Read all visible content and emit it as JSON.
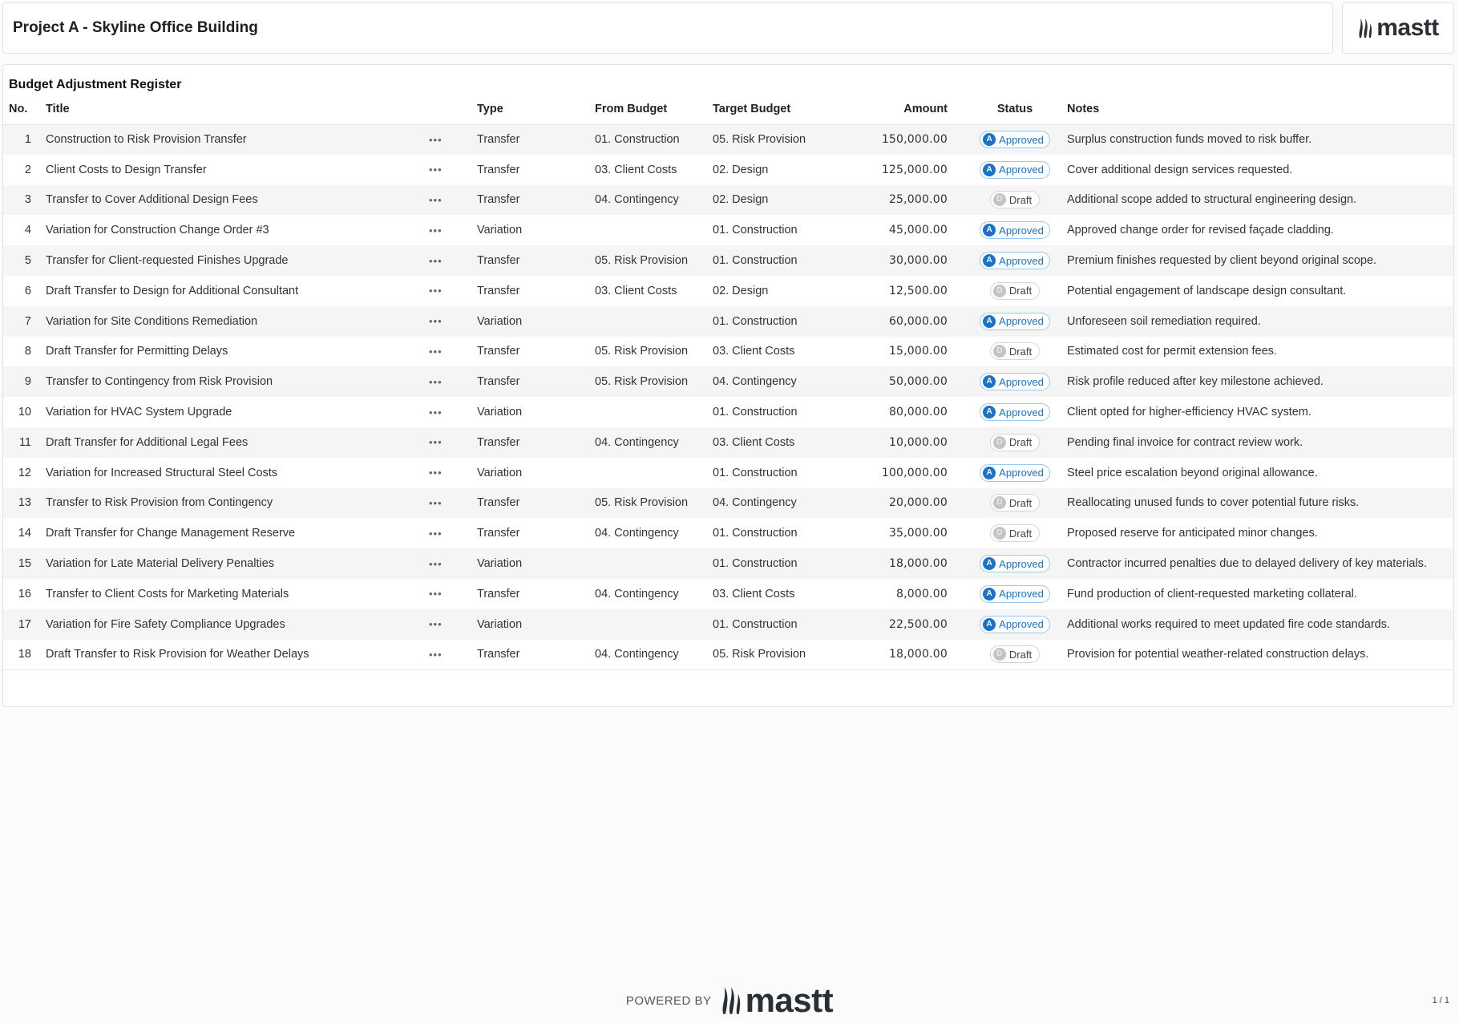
{
  "header": {
    "project_title": "Project A - Skyline Office Building",
    "logo_text": "mastt"
  },
  "register": {
    "title": "Budget Adjustment Register",
    "columns": {
      "no": "No.",
      "title": "Title",
      "type": "Type",
      "from": "From Budget",
      "target": "Target Budget",
      "amount": "Amount",
      "status": "Status",
      "notes": "Notes"
    },
    "rows": [
      {
        "no": "1",
        "title": "Construction to Risk Provision Transfer",
        "type": "Transfer",
        "from": "01. Construction",
        "target": "05. Risk Provision",
        "amount": "150,000.00",
        "status": "Approved",
        "status_letter": "A",
        "notes": "Surplus construction funds moved to risk buffer."
      },
      {
        "no": "2",
        "title": "Client Costs to Design Transfer",
        "type": "Transfer",
        "from": "03. Client Costs",
        "target": "02. Design",
        "amount": "125,000.00",
        "status": "Approved",
        "status_letter": "A",
        "notes": "Cover additional design services requested."
      },
      {
        "no": "3",
        "title": "Transfer to Cover Additional Design Fees",
        "type": "Transfer",
        "from": "04. Contingency",
        "target": "02. Design",
        "amount": "25,000.00",
        "status": "Draft",
        "status_letter": "D",
        "notes": "Additional scope added to structural engineering design."
      },
      {
        "no": "4",
        "title": "Variation for Construction Change Order #3",
        "type": "Variation",
        "from": "",
        "target": "01. Construction",
        "amount": "45,000.00",
        "status": "Approved",
        "status_letter": "A",
        "notes": "Approved change order for revised façade cladding."
      },
      {
        "no": "5",
        "title": "Transfer for Client-requested Finishes Upgrade",
        "type": "Transfer",
        "from": "05. Risk Provision",
        "target": "01. Construction",
        "amount": "30,000.00",
        "status": "Approved",
        "status_letter": "A",
        "notes": "Premium finishes requested by client beyond original scope."
      },
      {
        "no": "6",
        "title": "Draft Transfer to Design for Additional Consultant",
        "type": "Transfer",
        "from": "03. Client Costs",
        "target": "02. Design",
        "amount": "12,500.00",
        "status": "Draft",
        "status_letter": "D",
        "notes": "Potential engagement of landscape design consultant."
      },
      {
        "no": "7",
        "title": "Variation for Site Conditions Remediation",
        "type": "Variation",
        "from": "",
        "target": "01. Construction",
        "amount": "60,000.00",
        "status": "Approved",
        "status_letter": "A",
        "notes": "Unforeseen soil remediation required."
      },
      {
        "no": "8",
        "title": "Draft Transfer for Permitting Delays",
        "type": "Transfer",
        "from": "05. Risk Provision",
        "target": "03. Client Costs",
        "amount": "15,000.00",
        "status": "Draft",
        "status_letter": "D",
        "notes": "Estimated cost for permit extension fees."
      },
      {
        "no": "9",
        "title": "Transfer to Contingency from Risk Provision",
        "type": "Transfer",
        "from": "05. Risk Provision",
        "target": "04. Contingency",
        "amount": "50,000.00",
        "status": "Approved",
        "status_letter": "A",
        "notes": "Risk profile reduced after key milestone achieved."
      },
      {
        "no": "10",
        "title": "Variation for HVAC System Upgrade",
        "type": "Variation",
        "from": "",
        "target": "01. Construction",
        "amount": "80,000.00",
        "status": "Approved",
        "status_letter": "A",
        "notes": "Client opted for higher-efficiency HVAC system."
      },
      {
        "no": "11",
        "title": "Draft Transfer for Additional Legal Fees",
        "type": "Transfer",
        "from": "04. Contingency",
        "target": "03. Client Costs",
        "amount": "10,000.00",
        "status": "Draft",
        "status_letter": "D",
        "notes": "Pending final invoice for contract review work."
      },
      {
        "no": "12",
        "title": "Variation for Increased Structural Steel Costs",
        "type": "Variation",
        "from": "",
        "target": "01. Construction",
        "amount": "100,000.00",
        "status": "Approved",
        "status_letter": "A",
        "notes": "Steel price escalation beyond original allowance."
      },
      {
        "no": "13",
        "title": "Transfer to Risk Provision from Contingency",
        "type": "Transfer",
        "from": "05. Risk Provision",
        "target": "04. Contingency",
        "amount": "20,000.00",
        "status": "Draft",
        "status_letter": "D",
        "notes": "Reallocating unused funds to cover potential future risks."
      },
      {
        "no": "14",
        "title": "Draft Transfer for Change Management Reserve",
        "type": "Transfer",
        "from": "04. Contingency",
        "target": "01. Construction",
        "amount": "35,000.00",
        "status": "Draft",
        "status_letter": "D",
        "notes": "Proposed reserve for anticipated minor changes."
      },
      {
        "no": "15",
        "title": "Variation for Late Material Delivery Penalties",
        "type": "Variation",
        "from": "",
        "target": "01. Construction",
        "amount": "18,000.00",
        "status": "Approved",
        "status_letter": "A",
        "notes": "Contractor incurred penalties due to delayed delivery of key materials."
      },
      {
        "no": "16",
        "title": "Transfer to Client Costs for Marketing Materials",
        "type": "Transfer",
        "from": "04. Contingency",
        "target": "03. Client Costs",
        "amount": "8,000.00",
        "status": "Approved",
        "status_letter": "A",
        "notes": "Fund production of client-requested marketing collateral."
      },
      {
        "no": "17",
        "title": "Variation for Fire Safety Compliance Upgrades",
        "type": "Variation",
        "from": "",
        "target": "01. Construction",
        "amount": "22,500.00",
        "status": "Approved",
        "status_letter": "A",
        "notes": "Additional works required to meet updated fire code standards."
      },
      {
        "no": "18",
        "title": "Draft Transfer to Risk Provision for Weather Delays",
        "type": "Transfer",
        "from": "04. Contingency",
        "target": "05. Risk Provision",
        "amount": "18,000.00",
        "status": "Draft",
        "status_letter": "D",
        "notes": "Provision for potential weather-related construction delays."
      }
    ],
    "menu_glyph": "•••"
  },
  "footer": {
    "powered_by": "POWERED BY",
    "logo_text": "mastt",
    "page": "1 / 1"
  },
  "colors": {
    "approved": "#1a73c8",
    "draft": "#c4c4c4",
    "logo": "#2a2f36"
  },
  "icons": {
    "logo": "mastt-flame-logo-icon",
    "row_menu": "more-horizontal-icon"
  }
}
